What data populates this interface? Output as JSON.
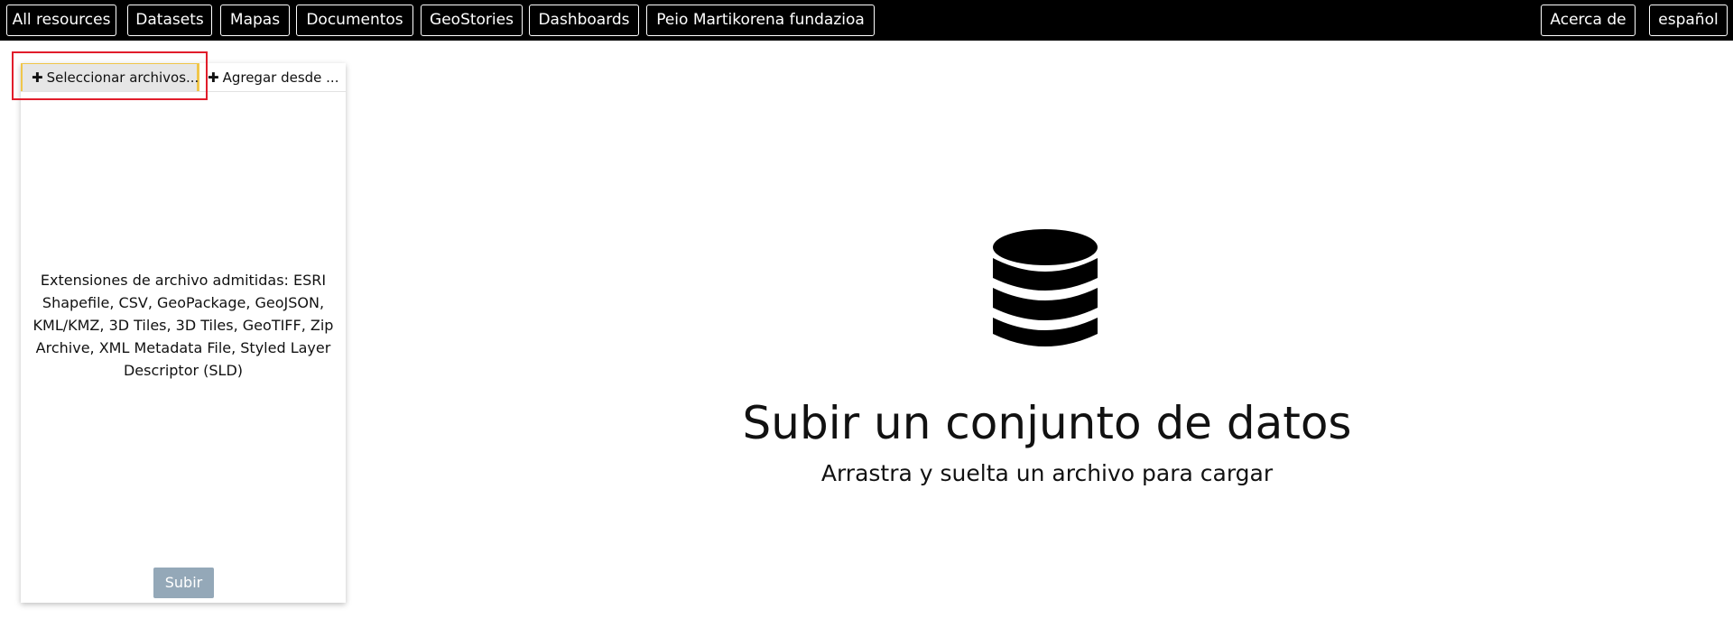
{
  "nav": {
    "items": [
      {
        "label": "All resources"
      },
      {
        "label": "Datasets"
      },
      {
        "label": "Mapas"
      },
      {
        "label": "Documentos"
      },
      {
        "label": "GeoStories"
      },
      {
        "label": "Dashboards"
      },
      {
        "label": "Peio Martikorena fundazioa"
      }
    ],
    "about": "Acerca de",
    "language": "español"
  },
  "upload_panel": {
    "tabs": {
      "select_files": "Seleccionar archivos...",
      "add_from_url": "Agregar desde ..."
    },
    "supported_extensions_text": "Extensiones de archivo admitidas: ESRI Shapefile, CSV, GeoPackage, GeoJSON, KML/KMZ, 3D Tiles, 3D Tiles, GeoTIFF, Zip Archive, XML Metadata File, Styled Layer Descriptor (SLD)",
    "submit_label": "Subir"
  },
  "main": {
    "icon": "database-icon",
    "title": "Subir un conjunto de datos",
    "subtitle": "Arrastra y suelta un archivo para cargar"
  },
  "colors": {
    "topbar": "#000000",
    "tab_selected_border": "#f0c64a",
    "highlight_box": "#e11d2b",
    "submit_disabled": "#94a8b8"
  }
}
